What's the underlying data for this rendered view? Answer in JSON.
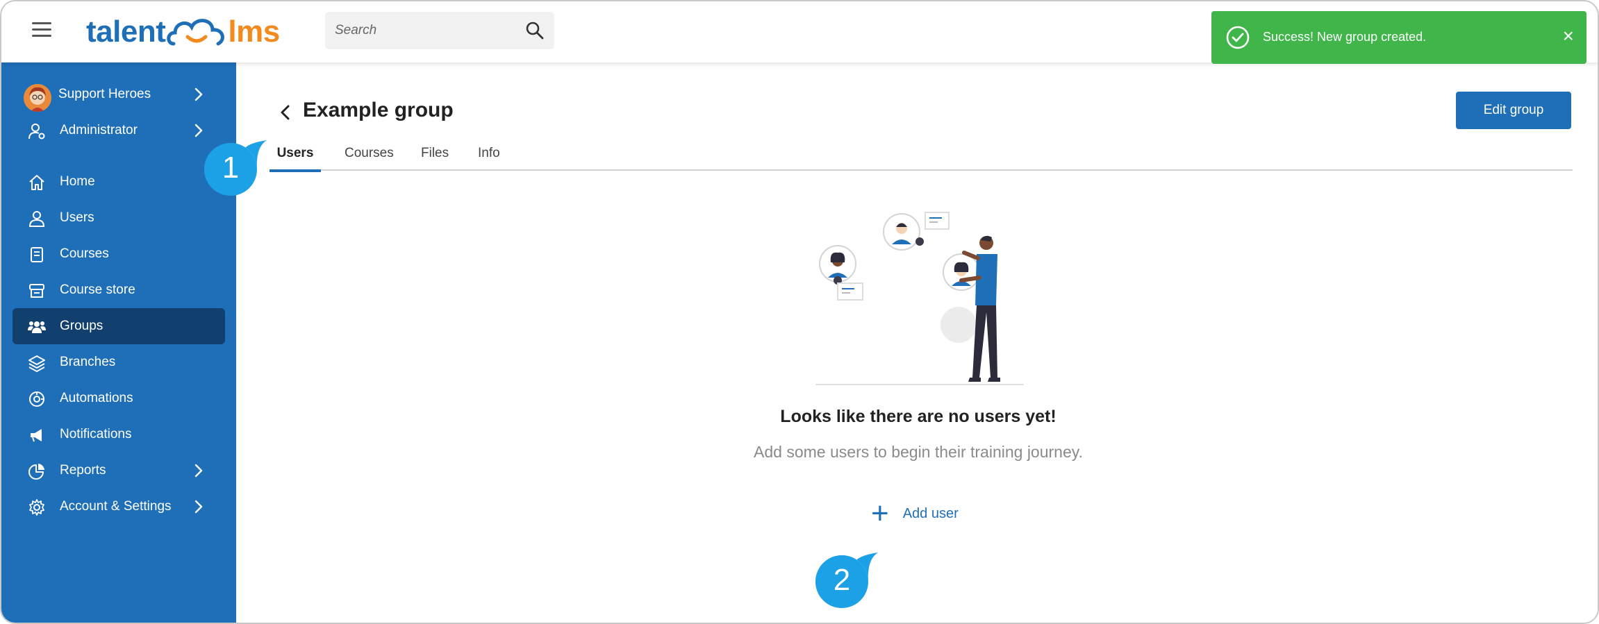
{
  "app": {
    "logo_left": "talent",
    "logo_right": "lms",
    "brand_color": "#1f6fb8",
    "accent_color": "#f28a1d"
  },
  "search": {
    "placeholder": "Search"
  },
  "toast": {
    "message": "Success! New group created.",
    "close_glyph": "×",
    "color": "#3fb54a"
  },
  "sidebar": {
    "profile": {
      "label": "Support Heroes"
    },
    "role": {
      "label": "Administrator"
    },
    "items": [
      {
        "label": "Home",
        "icon": "home-icon"
      },
      {
        "label": "Users",
        "icon": "user-icon"
      },
      {
        "label": "Courses",
        "icon": "book-icon"
      },
      {
        "label": "Course store",
        "icon": "store-icon"
      },
      {
        "label": "Groups",
        "icon": "groups-icon",
        "active": true
      },
      {
        "label": "Branches",
        "icon": "layers-icon"
      },
      {
        "label": "Automations",
        "icon": "automation-icon"
      },
      {
        "label": "Notifications",
        "icon": "megaphone-icon"
      },
      {
        "label": "Reports",
        "icon": "pie-chart-icon"
      },
      {
        "label": "Account & Settings",
        "icon": "gear-icon"
      }
    ]
  },
  "main": {
    "title": "Example group",
    "edit_button": "Edit group",
    "tabs": [
      {
        "label": "Users",
        "active": true
      },
      {
        "label": "Courses"
      },
      {
        "label": "Files"
      },
      {
        "label": "Info"
      }
    ],
    "empty_title": "Looks like there are no users yet!",
    "empty_subtitle": "Add some users to begin their training journey.",
    "add_user_label": "Add user",
    "add_user_glyph": "+"
  },
  "callouts": [
    {
      "number": "1"
    },
    {
      "number": "2"
    }
  ]
}
